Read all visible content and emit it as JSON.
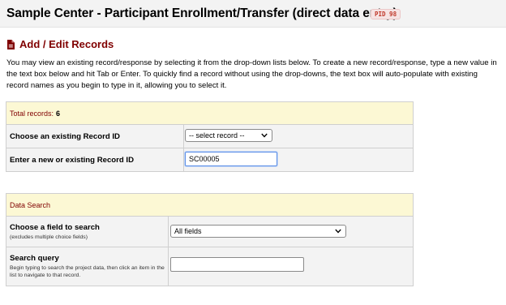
{
  "header": {
    "project_title": "Sample Center - Participant Enrollment/Transfer (direct data entry)",
    "pid_badge": "PID 98"
  },
  "page": {
    "section_title": "Add / Edit Records",
    "section_icon": "record-file-icon",
    "intro_text": "You may view an existing record/response by selecting it from the drop-down lists below. To create a new record/response, type a new value in the text box below and hit Tab or Enter. To quickly find a record without using the drop-downs, the text box will auto-populate with existing record names as you begin to type in it, allowing you to select it."
  },
  "records_table": {
    "total_label": "Total records:",
    "total_value": "6",
    "choose_label": "Choose an existing Record ID",
    "choose_select_value": "-- select record --",
    "enter_label": "Enter a new or existing Record ID",
    "enter_input_value": "SC00005"
  },
  "search_table": {
    "header": "Data Search",
    "field_label": "Choose a field to search",
    "field_sublabel": "(excludes multiple choice fields)",
    "field_select_value": "All fields",
    "query_label": "Search query",
    "query_sublabel": "Begin typing to search the project data, then click an item in the list to navigate to that record.",
    "query_input_value": ""
  },
  "colors": {
    "section_title": "#800000",
    "table_header_bg": "#fcf8d4",
    "table_body_bg": "#f3f3f3",
    "focus_border": "#5b8ee6"
  }
}
